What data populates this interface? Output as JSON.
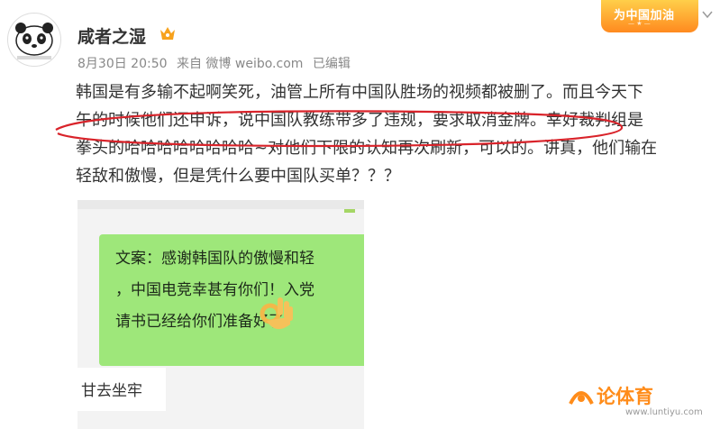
{
  "user": {
    "name": "咸者之湿"
  },
  "meta": {
    "date": "8月30日 20:50",
    "via": "来自 微博 weibo.com",
    "edited": "已编辑"
  },
  "banner": {
    "text": "为中国加油"
  },
  "post": {
    "lines": [
      "韩国是有多输不起啊笑死，油管上所有中国队胜场的视频都被删了。而且今天下",
      "午的时候他们还申诉，说中国队教练带多了违规，要求取消金牌。幸好裁判组是",
      "拳头的哈哈哈哈哈哈哈哈~对他们下限的认知再次刷新，可以的。讲真，他们输在",
      "轻敌和傲慢，但是凭什么要中国队买单？？？"
    ]
  },
  "chat": {
    "bubble_lines": [
      "文案：感谢韩国队的傲慢和轻",
      "，中国电竞幸甚有你们！入党",
      "请书已经给你们准备好了"
    ],
    "second_message": "甘去坐牢"
  },
  "watermark": {
    "brand": "论体育",
    "url": "www.luntiyu.com"
  },
  "colors": {
    "accent_orange": "#ff8c1a",
    "bubble_green": "#9ee77a",
    "circle_red": "#d9232a"
  }
}
